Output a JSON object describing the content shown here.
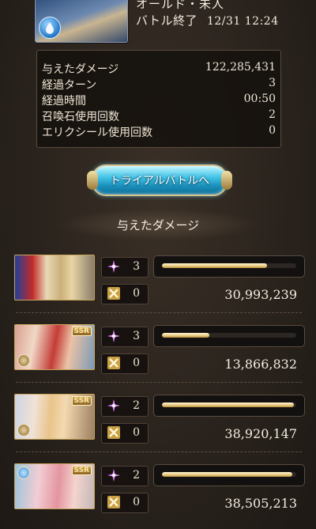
{
  "header": {
    "boss_name": "オールド・未人",
    "battle_status": "バトル終了",
    "battle_time": "12/31 12:24",
    "element_icon": "water-element-icon"
  },
  "stats": [
    {
      "label": "与えたダメージ",
      "value": "122,285,431"
    },
    {
      "label": "経過ターン",
      "value": "3"
    },
    {
      "label": "経過時間",
      "value": "00:50"
    },
    {
      "label": "召喚石使用回数",
      "value": "2"
    },
    {
      "label": "エリクシール使用回数",
      "value": "0"
    }
  ],
  "trial_button": {
    "label": "トライアルバトルへ"
  },
  "section_title": "与えたダメージ",
  "characters": [
    {
      "ougi_count": "3",
      "skill_count": "0",
      "damage": "30,993,239",
      "bar_fraction": 0.78,
      "ssr": "",
      "element": "light"
    },
    {
      "ougi_count": "3",
      "skill_count": "0",
      "damage": "13,866,832",
      "bar_fraction": 0.35,
      "ssr": "SSR",
      "element": "light"
    },
    {
      "ougi_count": "2",
      "skill_count": "0",
      "damage": "38,920,147",
      "bar_fraction": 0.98,
      "ssr": "SSR",
      "element": "light"
    },
    {
      "ougi_count": "2",
      "skill_count": "0",
      "damage": "38,505,213",
      "bar_fraction": 0.97,
      "ssr": "SSR",
      "element": "water"
    }
  ],
  "colors": {
    "background": "#2a231d",
    "bar_fill": "#e7c87c",
    "button": "#42c3e6",
    "ougi_icon": "#e889ff",
    "skill_icon": "#e8c25a"
  },
  "icons": {
    "ougi": "pink-sparkle-icon",
    "skill": "gold-cross-swords-icon"
  }
}
